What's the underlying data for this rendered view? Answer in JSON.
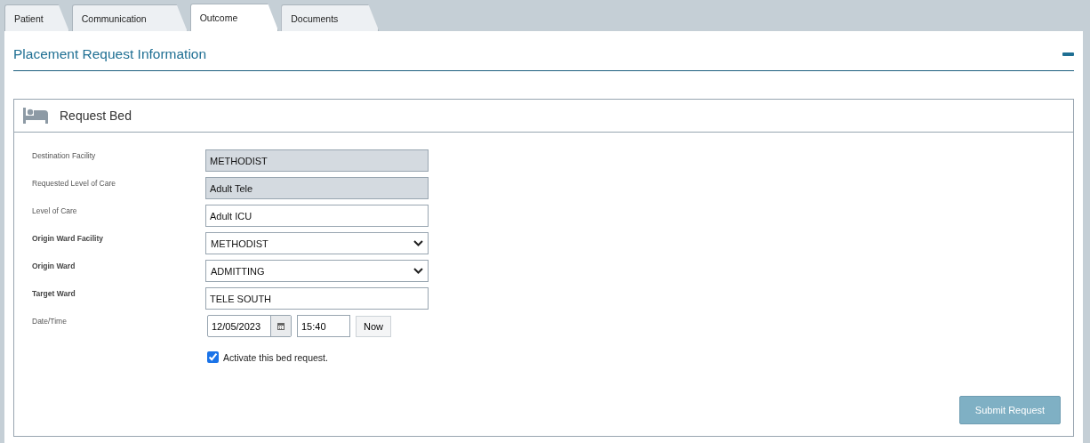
{
  "tabs": [
    {
      "label": "Patient",
      "selected": false
    },
    {
      "label": "Communication",
      "selected": false
    },
    {
      "label": "Outcome",
      "selected": true
    },
    {
      "label": "Documents",
      "selected": false
    }
  ],
  "section": {
    "title": "Placement Request Information",
    "expanded": true
  },
  "card": {
    "title": "Request Bed",
    "fields": [
      {
        "label": "Destination Facility",
        "kind": "readonly",
        "value": "METHODIST",
        "bold": false
      },
      {
        "label": "Requested Level of Care",
        "kind": "readonly",
        "value": "Adult Tele",
        "bold": false
      },
      {
        "label": "Level of Care",
        "kind": "text",
        "value": "Adult ICU",
        "bold": false
      },
      {
        "label": "Origin Ward Facility",
        "kind": "select",
        "value": "METHODIST",
        "bold": true
      },
      {
        "label": "Origin Ward",
        "kind": "select",
        "value": "ADMITTING",
        "bold": true
      },
      {
        "label": "Target Ward",
        "kind": "text",
        "value": "TELE SOUTH",
        "bold": true
      },
      {
        "label": "Date/Time",
        "kind": "datetime",
        "date": "12/05/2023",
        "time": "15:40",
        "button": "Now",
        "bold": false
      }
    ],
    "checkbox": {
      "label": "Activate this bed request.",
      "checked": true
    },
    "submit": {
      "label": "Submit Request",
      "disabled": true
    }
  }
}
